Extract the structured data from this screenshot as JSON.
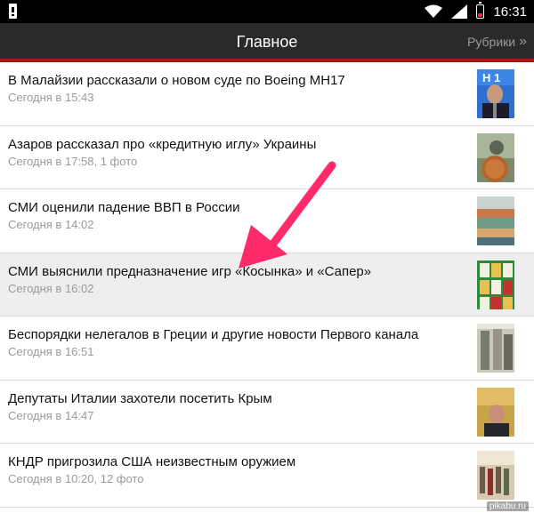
{
  "status_bar": {
    "time": "16:31"
  },
  "header": {
    "title": "Главное",
    "link_label": "Рубрики"
  },
  "items": [
    {
      "title": "В Малайзии рассказали о новом суде по Boeing MH17",
      "meta": "Сегодня в 15:43"
    },
    {
      "title": "Азаров рассказал про «кредитную иглу» Украины",
      "meta": "Сегодня в 17:58, 1 фото"
    },
    {
      "title": "СМИ оценили падение ВВП в России",
      "meta": "Сегодня в 14:02"
    },
    {
      "title": "СМИ выяснили предназначение игр «Косынка» и «Сапер»",
      "meta": "Сегодня в 16:02"
    },
    {
      "title": "Беспорядки нелегалов в Греции и другие новости Первого канала",
      "meta": "Сегодня в 16:51"
    },
    {
      "title": "Депутаты Италии захотели посетить Крым",
      "meta": "Сегодня в 14:47"
    },
    {
      "title": "КНДР пригрозила США неизвестным оружием",
      "meta": "Сегодня в 10:20, 12 фото"
    }
  ],
  "thumb_text": "H 1",
  "watermark": "pikabu.ru",
  "colors": {
    "header_bg": "#2a2a2a",
    "accent_red": "#b01414",
    "arrow": "#ff2a6a",
    "meta_gray": "#9a9a9a"
  }
}
